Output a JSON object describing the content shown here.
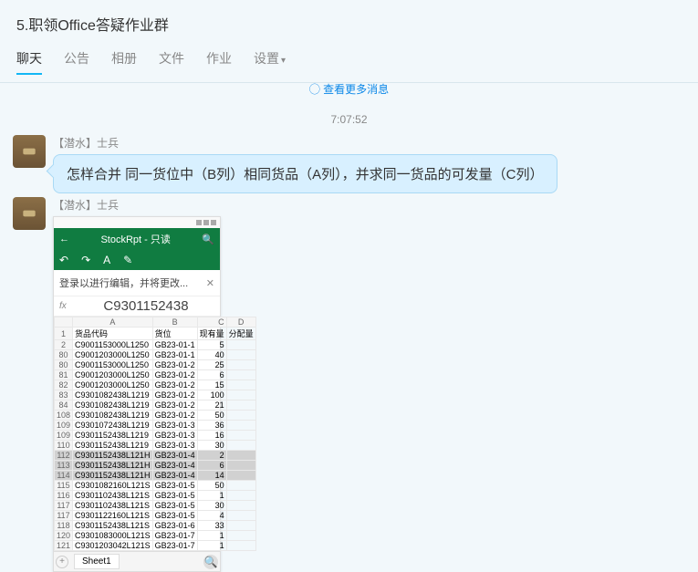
{
  "header": {
    "title": "5.职领Office答疑作业群"
  },
  "tabs": {
    "items": [
      {
        "label": "聊天",
        "active": true
      },
      {
        "label": "公告"
      },
      {
        "label": "相册"
      },
      {
        "label": "文件"
      },
      {
        "label": "作业"
      },
      {
        "label": "设置",
        "dropdown": true
      }
    ]
  },
  "system_msg": "◯ 查看更多消息",
  "timestamp": "7:07:52",
  "messages": [
    {
      "sender": "【潜水】士兵",
      "type": "text",
      "text": "怎样合并 同一货位中（B列）相同货品（A列），并求同一货品的可发量（C列）"
    },
    {
      "sender": "【潜水】士兵",
      "type": "image"
    }
  ],
  "phone": {
    "app_title": "StockRpt - 只读",
    "back": "←",
    "search": "🔍",
    "toolbar_icons": [
      "↶",
      "↷",
      "A",
      "✎"
    ],
    "login_msg": "登录以进行编辑，并将更改...",
    "close": "✕",
    "fx": "fx",
    "fx_value": "C9301152438",
    "cols": [
      "",
      "A",
      "B",
      "C",
      "D"
    ],
    "hdr": [
      "1",
      "货品代码",
      "货位",
      "现有量",
      "分配量"
    ],
    "rows": [
      [
        "2",
        "C9001153000L1250",
        "GB23-01-1",
        "5",
        ""
      ],
      [
        "80",
        "C9001203000L1250",
        "GB23-01-1",
        "40",
        ""
      ],
      [
        "80",
        "C9001153000L1250",
        "GB23-01-2",
        "25",
        ""
      ],
      [
        "81",
        "C9001203000L1250",
        "GB23-01-2",
        "6",
        ""
      ],
      [
        "82",
        "C9001203000L1250",
        "GB23-01-2",
        "15",
        ""
      ],
      [
        "83",
        "C9301082438L1219",
        "GB23-01-2",
        "100",
        ""
      ],
      [
        "84",
        "C9301082438L1219",
        "GB23-01-2",
        "21",
        ""
      ],
      [
        "108",
        "C9301082438L1219",
        "GB23-01-2",
        "50",
        ""
      ],
      [
        "109",
        "C9301072438L1219",
        "GB23-01-3",
        "36",
        ""
      ],
      [
        "109",
        "C9301152438L1219",
        "GB23-01-3",
        "16",
        ""
      ],
      [
        "110",
        "C9301152438L1219",
        "GB23-01-3",
        "30",
        ""
      ]
    ],
    "rows_sel": [
      [
        "112",
        "C9301152438L121H",
        "GB23-01-4",
        "2",
        ""
      ],
      [
        "113",
        "C9301152438L121H",
        "GB23-01-4",
        "6",
        ""
      ],
      [
        "114",
        "C9301152438L121H",
        "GB23-01-4",
        "14",
        ""
      ]
    ],
    "rows2": [
      [
        "115",
        "C9301082160L121S",
        "GB23-01-5",
        "50",
        ""
      ],
      [
        "116",
        "C9301102438L121S",
        "GB23-01-5",
        "1",
        ""
      ],
      [
        "117",
        "C9301102438L121S",
        "GB23-01-5",
        "30",
        ""
      ],
      [
        "117",
        "C9301122160L121S",
        "GB23-01-5",
        "4",
        ""
      ],
      [
        "118",
        "C9301152438L121S",
        "GB23-01-6",
        "33",
        ""
      ],
      [
        "120",
        "C9301083000L121S",
        "GB23-01-7",
        "1",
        ""
      ],
      [
        "121",
        "C9301203042L121S",
        "GB23-01-7",
        "1",
        ""
      ]
    ],
    "sheet": "Sheet1",
    "plus": "+",
    "zoom": "🔍"
  }
}
